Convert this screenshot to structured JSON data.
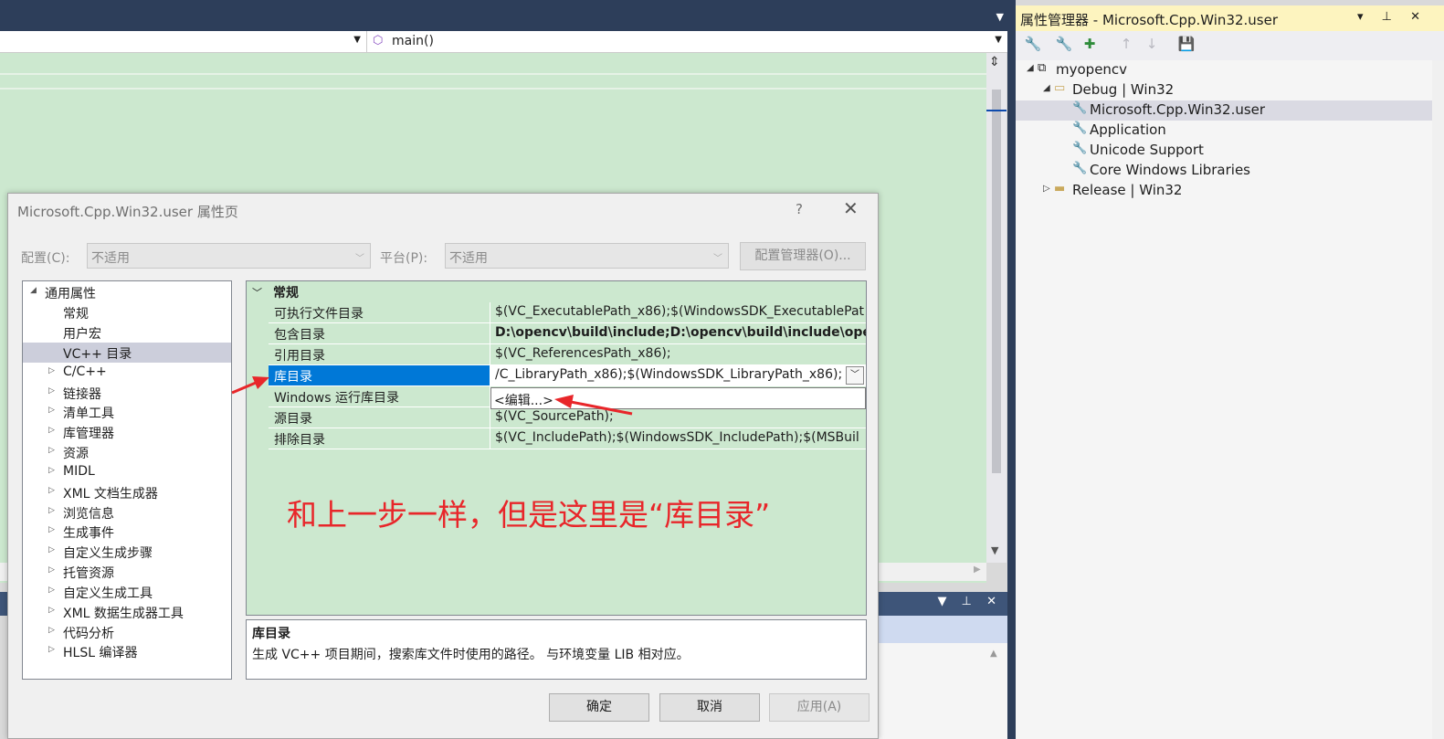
{
  "editor": {
    "function_selector": "main()"
  },
  "property_manager": {
    "title": "属性管理器 - Microsoft.Cpp.Win32.user",
    "tree": {
      "project": "myopencv",
      "debug_config": "Debug | Win32",
      "sheets": [
        "Microsoft.Cpp.Win32.user",
        "Application",
        "Unicode Support",
        "Core Windows Libraries"
      ],
      "release_config": "Release | Win32"
    }
  },
  "dialog": {
    "title": "Microsoft.Cpp.Win32.user 属性页",
    "help": "?",
    "close": "✕",
    "config_label": "配置(C):",
    "config_value": "不适用",
    "platform_label": "平台(P):",
    "platform_value": "不适用",
    "config_manager_button": "配置管理器(O)...",
    "tree": {
      "root": "通用属性",
      "items": [
        "常规",
        "用户宏",
        "VC++ 目录"
      ],
      "groups": [
        "C/C++",
        "链接器",
        "清单工具",
        "库管理器",
        "资源",
        "MIDL",
        "XML 文档生成器",
        "浏览信息",
        "生成事件",
        "自定义生成步骤",
        "托管资源",
        "自定义生成工具",
        "XML 数据生成器工具",
        "代码分析",
        "HLSL 编译器"
      ]
    },
    "grid": {
      "category": "常规",
      "rows": [
        {
          "name": "可执行文件目录",
          "value": "$(VC_ExecutablePath_x86);$(WindowsSDK_ExecutablePat"
        },
        {
          "name": "包含目录",
          "value": "D:\\opencv\\build\\include;D:\\opencv\\build\\include\\ope"
        },
        {
          "name": "引用目录",
          "value": "$(VC_ReferencesPath_x86);"
        },
        {
          "name": "库目录",
          "value": "/C_LibraryPath_x86);$(WindowsSDK_LibraryPath_x86);"
        },
        {
          "name": "Windows 运行库目录",
          "value": ""
        },
        {
          "name": "源目录",
          "value": "$(VC_SourcePath);"
        },
        {
          "name": "排除目录",
          "value": "$(VC_IncludePath);$(WindowsSDK_IncludePath);$(MSBuil"
        }
      ],
      "edit_option": "<编辑...>"
    },
    "annotation": "和上一步一样，但是这里是“库目录”",
    "description": {
      "title": "库目录",
      "text": "生成 VC++ 项目期间，搜索库文件时使用的路径。 与环境变量 LIB 相对应。"
    },
    "buttons": {
      "ok": "确定",
      "cancel": "取消",
      "apply": "应用(A)"
    }
  },
  "colors": {
    "editor_bg": "#cce8cf",
    "ide_chrome": "#2d3e5a",
    "selection": "#0078d7",
    "annotation": "#e8262a"
  }
}
